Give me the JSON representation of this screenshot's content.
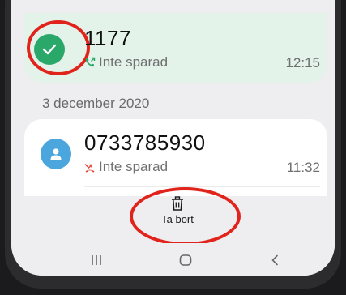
{
  "calls": [
    {
      "number": "1177",
      "status": "Inte sparad",
      "time": "12:15",
      "selected": true,
      "call_type_icon": "outgoing-call-icon"
    },
    {
      "number": "0733785930",
      "status": "Inte sparad",
      "time": "11:32",
      "selected": false,
      "call_type_icon": "missed-call-icon"
    }
  ],
  "date_header": "3 december 2020",
  "actions": {
    "delete_label": "Ta bort",
    "delete_icon": "trash-icon"
  },
  "navbar": {
    "recent_icon": "recent-apps-icon",
    "home_icon": "home-icon",
    "back_icon": "back-icon"
  },
  "colors": {
    "selected_card": "#e3f3ea",
    "check_avatar": "#2aa869",
    "contact_avatar": "#4aa6dc",
    "highlight_ring": "#e0241c",
    "missed_call": "#e24a3b"
  }
}
